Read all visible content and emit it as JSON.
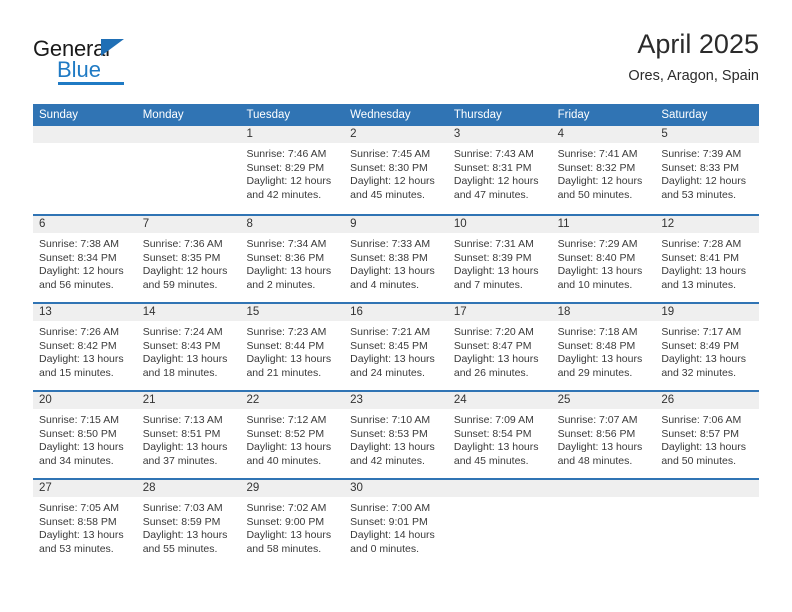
{
  "brand": {
    "name_primary": "General",
    "name_secondary": "Blue"
  },
  "header": {
    "title": "April 2025",
    "location": "Ores, Aragon, Spain"
  },
  "colors": {
    "header_blue": "#3074b4",
    "brand_blue": "#1f7ac4",
    "day_band_gray": "#efefef",
    "text": "#333333"
  },
  "weekday_headers": [
    "Sunday",
    "Monday",
    "Tuesday",
    "Wednesday",
    "Thursday",
    "Friday",
    "Saturday"
  ],
  "weeks": [
    [
      {
        "day": "",
        "sunrise": "",
        "sunset": "",
        "daylight_1": "",
        "daylight_2": ""
      },
      {
        "day": "",
        "sunrise": "",
        "sunset": "",
        "daylight_1": "",
        "daylight_2": ""
      },
      {
        "day": "1",
        "sunrise": "Sunrise: 7:46 AM",
        "sunset": "Sunset: 8:29 PM",
        "daylight_1": "Daylight: 12 hours",
        "daylight_2": "and 42 minutes."
      },
      {
        "day": "2",
        "sunrise": "Sunrise: 7:45 AM",
        "sunset": "Sunset: 8:30 PM",
        "daylight_1": "Daylight: 12 hours",
        "daylight_2": "and 45 minutes."
      },
      {
        "day": "3",
        "sunrise": "Sunrise: 7:43 AM",
        "sunset": "Sunset: 8:31 PM",
        "daylight_1": "Daylight: 12 hours",
        "daylight_2": "and 47 minutes."
      },
      {
        "day": "4",
        "sunrise": "Sunrise: 7:41 AM",
        "sunset": "Sunset: 8:32 PM",
        "daylight_1": "Daylight: 12 hours",
        "daylight_2": "and 50 minutes."
      },
      {
        "day": "5",
        "sunrise": "Sunrise: 7:39 AM",
        "sunset": "Sunset: 8:33 PM",
        "daylight_1": "Daylight: 12 hours",
        "daylight_2": "and 53 minutes."
      }
    ],
    [
      {
        "day": "6",
        "sunrise": "Sunrise: 7:38 AM",
        "sunset": "Sunset: 8:34 PM",
        "daylight_1": "Daylight: 12 hours",
        "daylight_2": "and 56 minutes."
      },
      {
        "day": "7",
        "sunrise": "Sunrise: 7:36 AM",
        "sunset": "Sunset: 8:35 PM",
        "daylight_1": "Daylight: 12 hours",
        "daylight_2": "and 59 minutes."
      },
      {
        "day": "8",
        "sunrise": "Sunrise: 7:34 AM",
        "sunset": "Sunset: 8:36 PM",
        "daylight_1": "Daylight: 13 hours",
        "daylight_2": "and 2 minutes."
      },
      {
        "day": "9",
        "sunrise": "Sunrise: 7:33 AM",
        "sunset": "Sunset: 8:38 PM",
        "daylight_1": "Daylight: 13 hours",
        "daylight_2": "and 4 minutes."
      },
      {
        "day": "10",
        "sunrise": "Sunrise: 7:31 AM",
        "sunset": "Sunset: 8:39 PM",
        "daylight_1": "Daylight: 13 hours",
        "daylight_2": "and 7 minutes."
      },
      {
        "day": "11",
        "sunrise": "Sunrise: 7:29 AM",
        "sunset": "Sunset: 8:40 PM",
        "daylight_1": "Daylight: 13 hours",
        "daylight_2": "and 10 minutes."
      },
      {
        "day": "12",
        "sunrise": "Sunrise: 7:28 AM",
        "sunset": "Sunset: 8:41 PM",
        "daylight_1": "Daylight: 13 hours",
        "daylight_2": "and 13 minutes."
      }
    ],
    [
      {
        "day": "13",
        "sunrise": "Sunrise: 7:26 AM",
        "sunset": "Sunset: 8:42 PM",
        "daylight_1": "Daylight: 13 hours",
        "daylight_2": "and 15 minutes."
      },
      {
        "day": "14",
        "sunrise": "Sunrise: 7:24 AM",
        "sunset": "Sunset: 8:43 PM",
        "daylight_1": "Daylight: 13 hours",
        "daylight_2": "and 18 minutes."
      },
      {
        "day": "15",
        "sunrise": "Sunrise: 7:23 AM",
        "sunset": "Sunset: 8:44 PM",
        "daylight_1": "Daylight: 13 hours",
        "daylight_2": "and 21 minutes."
      },
      {
        "day": "16",
        "sunrise": "Sunrise: 7:21 AM",
        "sunset": "Sunset: 8:45 PM",
        "daylight_1": "Daylight: 13 hours",
        "daylight_2": "and 24 minutes."
      },
      {
        "day": "17",
        "sunrise": "Sunrise: 7:20 AM",
        "sunset": "Sunset: 8:47 PM",
        "daylight_1": "Daylight: 13 hours",
        "daylight_2": "and 26 minutes."
      },
      {
        "day": "18",
        "sunrise": "Sunrise: 7:18 AM",
        "sunset": "Sunset: 8:48 PM",
        "daylight_1": "Daylight: 13 hours",
        "daylight_2": "and 29 minutes."
      },
      {
        "day": "19",
        "sunrise": "Sunrise: 7:17 AM",
        "sunset": "Sunset: 8:49 PM",
        "daylight_1": "Daylight: 13 hours",
        "daylight_2": "and 32 minutes."
      }
    ],
    [
      {
        "day": "20",
        "sunrise": "Sunrise: 7:15 AM",
        "sunset": "Sunset: 8:50 PM",
        "daylight_1": "Daylight: 13 hours",
        "daylight_2": "and 34 minutes."
      },
      {
        "day": "21",
        "sunrise": "Sunrise: 7:13 AM",
        "sunset": "Sunset: 8:51 PM",
        "daylight_1": "Daylight: 13 hours",
        "daylight_2": "and 37 minutes."
      },
      {
        "day": "22",
        "sunrise": "Sunrise: 7:12 AM",
        "sunset": "Sunset: 8:52 PM",
        "daylight_1": "Daylight: 13 hours",
        "daylight_2": "and 40 minutes."
      },
      {
        "day": "23",
        "sunrise": "Sunrise: 7:10 AM",
        "sunset": "Sunset: 8:53 PM",
        "daylight_1": "Daylight: 13 hours",
        "daylight_2": "and 42 minutes."
      },
      {
        "day": "24",
        "sunrise": "Sunrise: 7:09 AM",
        "sunset": "Sunset: 8:54 PM",
        "daylight_1": "Daylight: 13 hours",
        "daylight_2": "and 45 minutes."
      },
      {
        "day": "25",
        "sunrise": "Sunrise: 7:07 AM",
        "sunset": "Sunset: 8:56 PM",
        "daylight_1": "Daylight: 13 hours",
        "daylight_2": "and 48 minutes."
      },
      {
        "day": "26",
        "sunrise": "Sunrise: 7:06 AM",
        "sunset": "Sunset: 8:57 PM",
        "daylight_1": "Daylight: 13 hours",
        "daylight_2": "and 50 minutes."
      }
    ],
    [
      {
        "day": "27",
        "sunrise": "Sunrise: 7:05 AM",
        "sunset": "Sunset: 8:58 PM",
        "daylight_1": "Daylight: 13 hours",
        "daylight_2": "and 53 minutes."
      },
      {
        "day": "28",
        "sunrise": "Sunrise: 7:03 AM",
        "sunset": "Sunset: 8:59 PM",
        "daylight_1": "Daylight: 13 hours",
        "daylight_2": "and 55 minutes."
      },
      {
        "day": "29",
        "sunrise": "Sunrise: 7:02 AM",
        "sunset": "Sunset: 9:00 PM",
        "daylight_1": "Daylight: 13 hours",
        "daylight_2": "and 58 minutes."
      },
      {
        "day": "30",
        "sunrise": "Sunrise: 7:00 AM",
        "sunset": "Sunset: 9:01 PM",
        "daylight_1": "Daylight: 14 hours",
        "daylight_2": "and 0 minutes."
      },
      {
        "day": "",
        "sunrise": "",
        "sunset": "",
        "daylight_1": "",
        "daylight_2": ""
      },
      {
        "day": "",
        "sunrise": "",
        "sunset": "",
        "daylight_1": "",
        "daylight_2": ""
      },
      {
        "day": "",
        "sunrise": "",
        "sunset": "",
        "daylight_1": "",
        "daylight_2": ""
      }
    ]
  ]
}
